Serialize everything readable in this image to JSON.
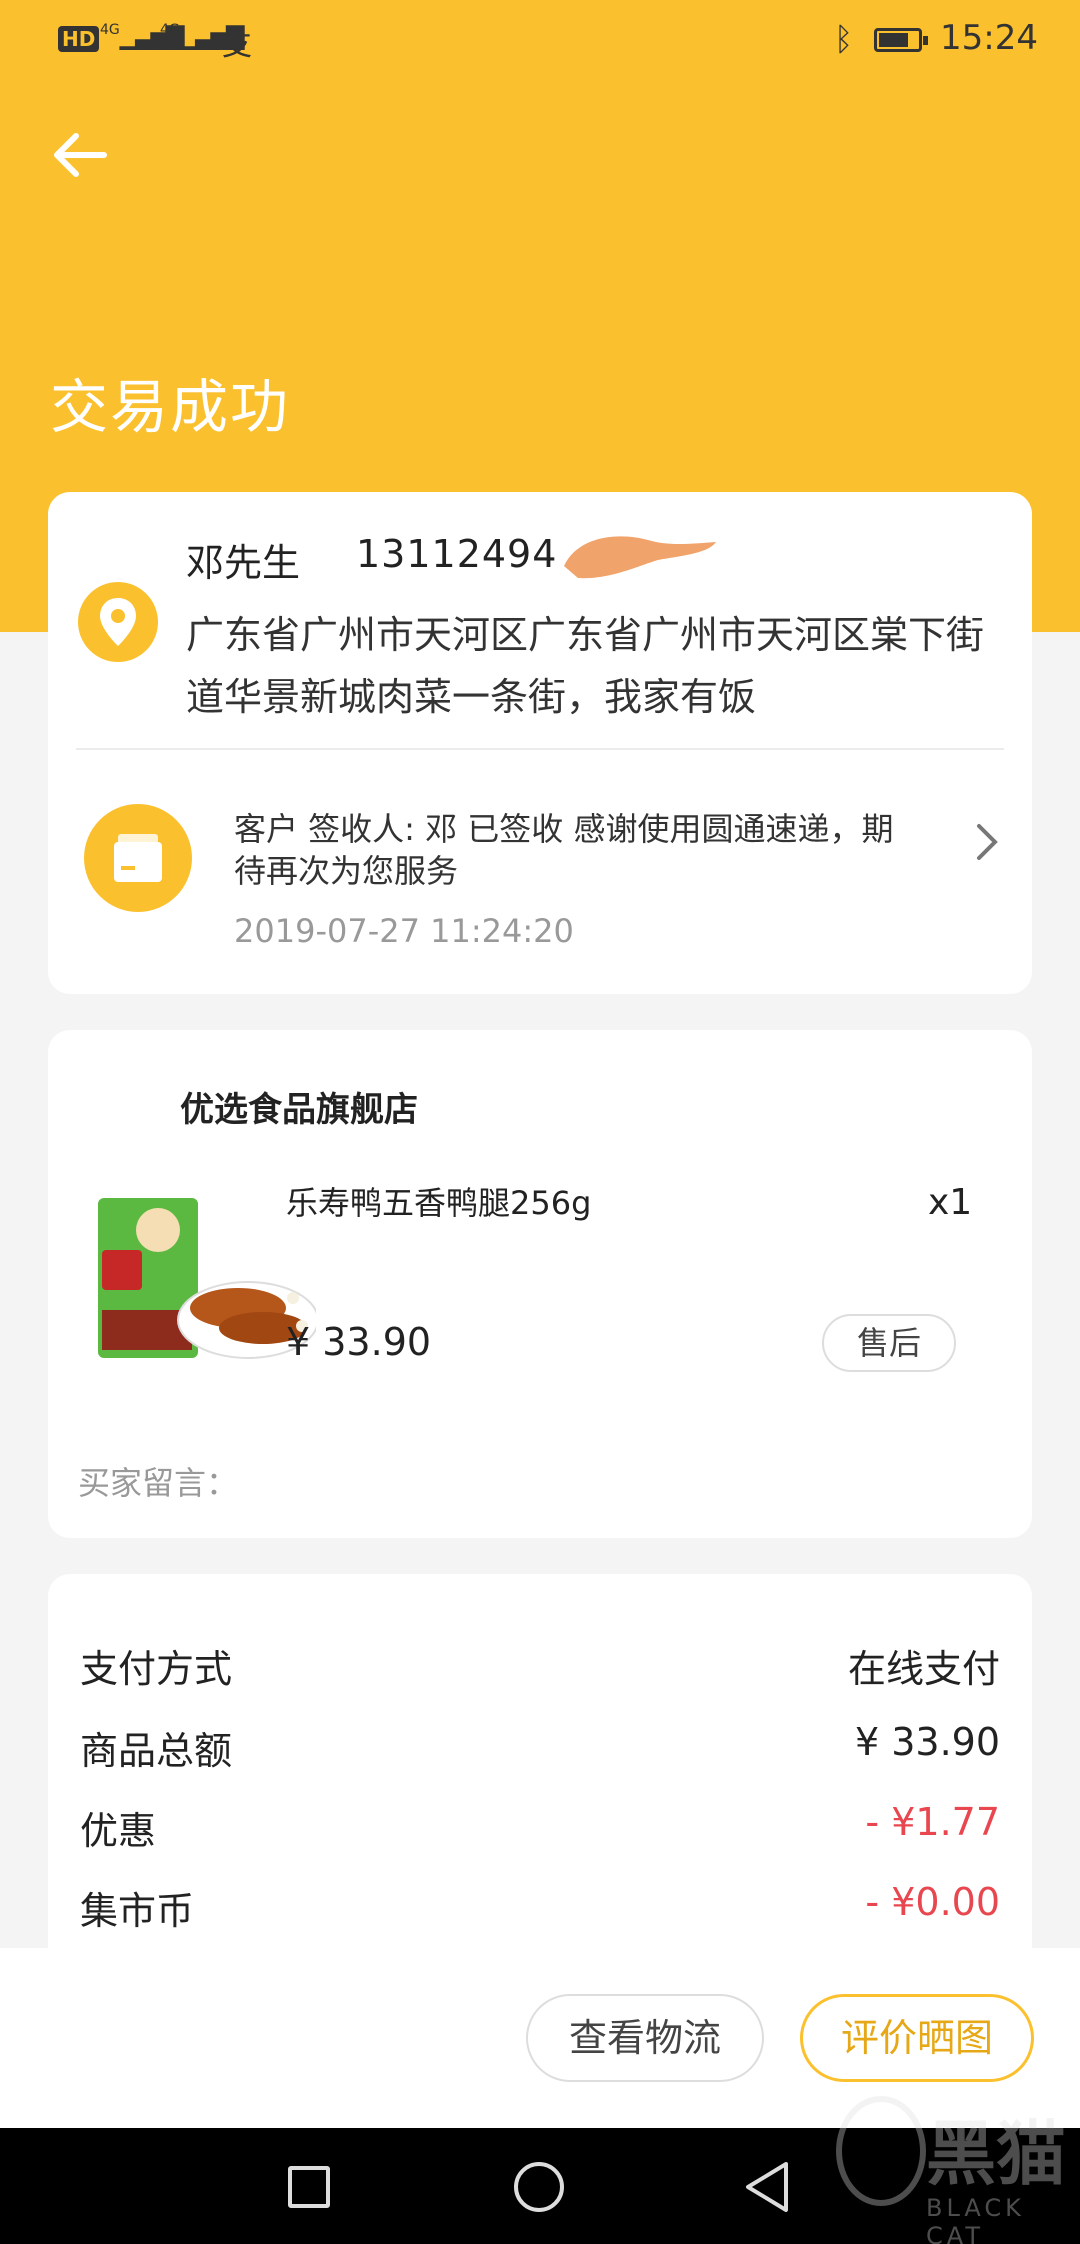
{
  "status_bar": {
    "hd": "HD",
    "network1": "4G",
    "network2": "4G",
    "pay_icon": "alipay-icon",
    "bluetooth_icon": "bluetooth-icon",
    "battery_level": 0.75,
    "time": "15:24"
  },
  "header": {
    "back_icon": "arrow-left-icon",
    "title": "交易成功"
  },
  "address": {
    "name": "邓先生",
    "phone": "13112494",
    "text": "广东省广州市天河区广东省广州市天河区棠下街道华景新城肉菜一条街，我家有饭"
  },
  "logistics": {
    "status": "客户 签收人: 邓 已签收 感谢使用圆通速递，期待再次为您服务",
    "time": "2019-07-27 11:24:20"
  },
  "shop": {
    "name": "优选食品旗舰店",
    "product_title": "乐寿鸭五香鸭腿256g",
    "quantity": "x1",
    "price": "¥ 33.90",
    "aftersale_label": "售后",
    "message_label": "买家留言："
  },
  "payment": {
    "rows": [
      {
        "label": "支付方式",
        "value": "在线支付"
      },
      {
        "label": "商品总额",
        "value": "¥ 33.90"
      },
      {
        "label": "优惠",
        "value": "- ¥1.77"
      },
      {
        "label": "集市币",
        "value": "- ¥0.00"
      }
    ]
  },
  "actions": {
    "logistics_label": "查看物流",
    "review_label": "评价晒图"
  },
  "watermark": {
    "text": "黑猫",
    "sub": "BLACK CAT"
  },
  "colors": {
    "brand": "#fbc02d",
    "discount_red": "#e8474f"
  }
}
